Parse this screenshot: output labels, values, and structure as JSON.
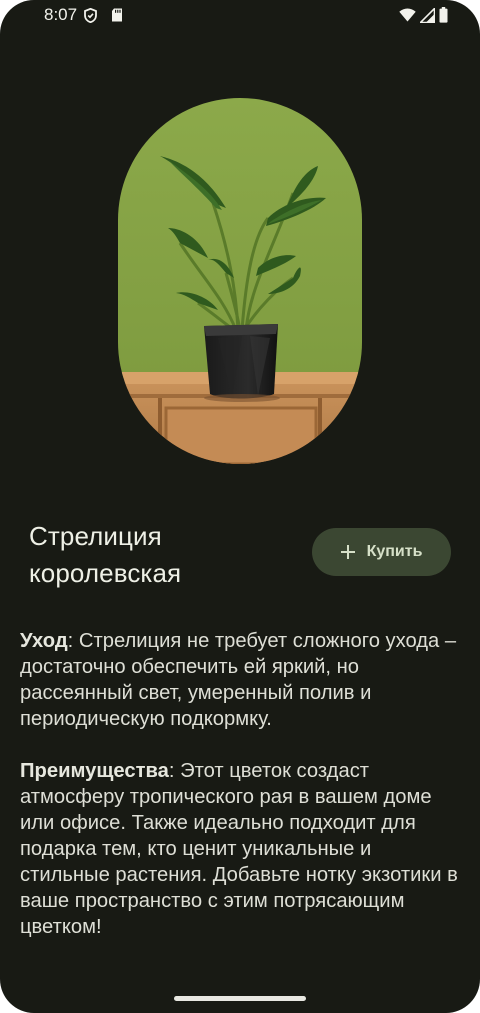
{
  "status_bar": {
    "time": "8:07",
    "left_icons": [
      "shield-icon",
      "sd-card-icon"
    ],
    "right_icons": [
      "wifi-icon",
      "cellular-signal-icon",
      "battery-icon"
    ]
  },
  "product": {
    "title_line1": "Стрелиция",
    "title_line2": "королевская",
    "image_icon": "plant-photo",
    "buy_button": {
      "icon": "plus-icon",
      "label": "Купить"
    }
  },
  "description": {
    "care": {
      "label": "Уход",
      "text": ": Стрелиция не требует сложного ухода – достаточно обеспечить ей яркий, но рассеянный свет, умеренный полив и периодическую подкормку."
    },
    "benefits": {
      "label": "Преимущества",
      "text": ": Этот цветок создаст атмосферу тропического рая в вашем доме или офисе. Также идеально подходит для подарка тем, кто ценит уникальные и стильные растения. Добавьте нотку экзотики в ваше пространство с этим потрясающим цветком!"
    }
  },
  "colors": {
    "background": "#181a14",
    "button_bg": "#3b4732",
    "button_text": "#d6e0c8",
    "text": "#dedfd6"
  }
}
